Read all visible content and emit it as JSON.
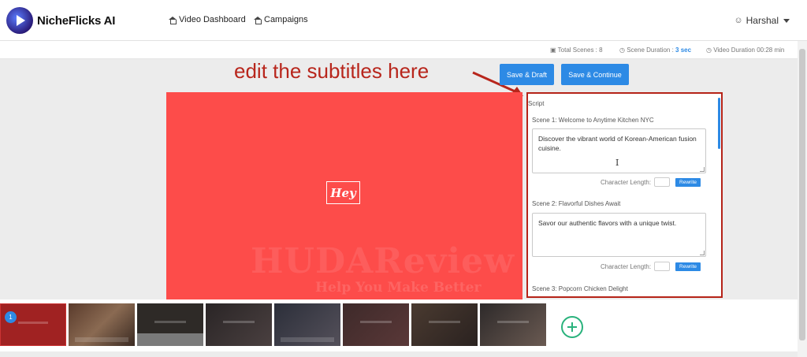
{
  "app": {
    "name": "NicheFlicks AI"
  },
  "nav": {
    "video_dashboard": "Video Dashboard",
    "campaigns": "Campaigns",
    "user": "Harshal"
  },
  "stats": {
    "total_scenes_label": "Total Scenes : 8",
    "scene_duration_label": "Scene Duration :",
    "scene_duration_value": "3 sec",
    "video_duration_label": "Video Duration 00:28 min"
  },
  "annotation": "edit the subtitles here",
  "toolbar": {
    "save_draft": "Save & Draft",
    "save_continue": "Save & Continue"
  },
  "preview": {
    "text": "Hey",
    "bg_color": "#fd4c4a"
  },
  "script": {
    "title": "Script",
    "char_length_label": "Character Length:",
    "rewrite_label": "Rewrite",
    "scenes": [
      {
        "title": "Scene 1: Welcome to Anytime Kitchen NYC",
        "text": "Discover the vibrant world of Korean-American fusion cuisine."
      },
      {
        "title": "Scene 2: Flavorful Dishes Await",
        "text": "Savor our authentic flavors with a unique twist."
      },
      {
        "title": "Scene 3: Popcorn Chicken Delight"
      }
    ]
  },
  "timeline": {
    "selected_badge": "1",
    "thumb_count": 8
  },
  "watermark": {
    "line1": "HUDAReview",
    "line2": "Help You Make Better"
  },
  "colors": {
    "accent": "#2d8ae5",
    "annotation": "#b8261c",
    "add": "#29b27c"
  }
}
